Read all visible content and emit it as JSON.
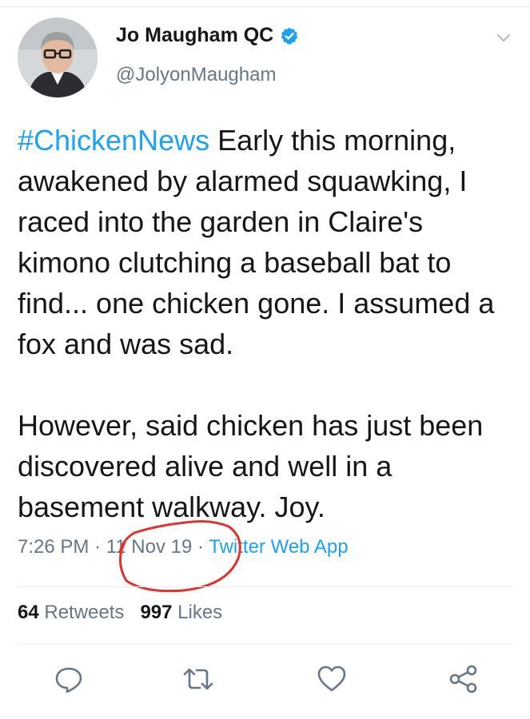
{
  "author": {
    "name": "Jo Maugham QC",
    "handle": "@JolyonMaugham",
    "verified_icon": "verified-badge-icon"
  },
  "tweet": {
    "hashtag": "#ChickenNews",
    "text_part1": " Early this morning, awakened by alarmed squawking, I raced into the garden in Claire's kimono clutching a baseball bat to find... one chicken gone. I assumed a fox and was sad.",
    "text_part2": "However, said chicken has just been discovered alive and well in a basement walkway. Joy."
  },
  "meta": {
    "time": "7:26 PM",
    "separator": " · ",
    "date": "11 Nov 19",
    "source": "Twitter Web App"
  },
  "stats": {
    "retweets_count": "64",
    "retweets_label": " Retweets",
    "likes_count": "997",
    "likes_label": " Likes"
  },
  "colors": {
    "accent": "#1da1f2",
    "secondary_text": "#657786",
    "annotation_red": "#e0322f"
  },
  "actions": [
    "reply-icon",
    "retweet-icon",
    "like-icon",
    "share-icon"
  ]
}
